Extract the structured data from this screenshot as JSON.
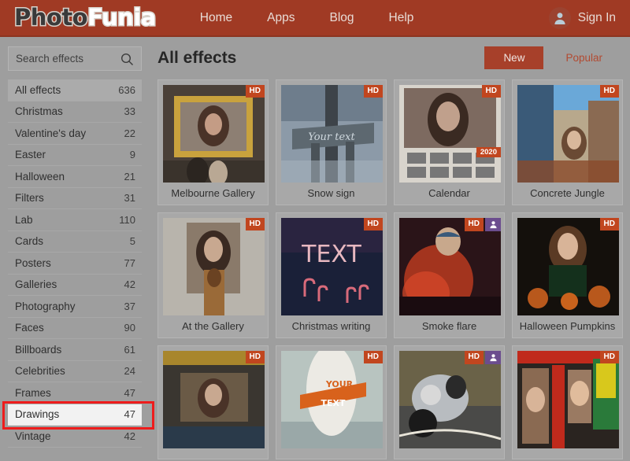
{
  "header": {
    "logo_part1": "Photo",
    "logo_part2": "Funia",
    "nav": [
      {
        "label": "Home"
      },
      {
        "label": "Apps"
      },
      {
        "label": "Blog"
      },
      {
        "label": "Help"
      }
    ],
    "signin_label": "Sign In",
    "avatar_icon": "user-avatar-icon",
    "bg_color": "#a03a24"
  },
  "sidebar": {
    "search": {
      "placeholder": "Search effects",
      "value": "",
      "icon": "search-icon"
    },
    "categories": [
      {
        "label": "All effects",
        "count": "636",
        "active": true,
        "highlighted": false
      },
      {
        "label": "Christmas",
        "count": "33",
        "active": false,
        "highlighted": false
      },
      {
        "label": "Valentine's day",
        "count": "22",
        "active": false,
        "highlighted": false
      },
      {
        "label": "Easter",
        "count": "9",
        "active": false,
        "highlighted": false
      },
      {
        "label": "Halloween",
        "count": "21",
        "active": false,
        "highlighted": false
      },
      {
        "label": "Filters",
        "count": "31",
        "active": false,
        "highlighted": false
      },
      {
        "label": "Lab",
        "count": "110",
        "active": false,
        "highlighted": false
      },
      {
        "label": "Cards",
        "count": "5",
        "active": false,
        "highlighted": false
      },
      {
        "label": "Posters",
        "count": "77",
        "active": false,
        "highlighted": false
      },
      {
        "label": "Galleries",
        "count": "42",
        "active": false,
        "highlighted": false
      },
      {
        "label": "Photography",
        "count": "37",
        "active": false,
        "highlighted": false
      },
      {
        "label": "Faces",
        "count": "90",
        "active": false,
        "highlighted": false
      },
      {
        "label": "Billboards",
        "count": "61",
        "active": false,
        "highlighted": false
      },
      {
        "label": "Celebrities",
        "count": "24",
        "active": false,
        "highlighted": false
      },
      {
        "label": "Frames",
        "count": "47",
        "active": false,
        "highlighted": false
      },
      {
        "label": "Drawings",
        "count": "47",
        "active": false,
        "highlighted": true
      },
      {
        "label": "Vintage",
        "count": "42",
        "active": false,
        "highlighted": false
      }
    ],
    "annotation_color": "#ee1c1c"
  },
  "main": {
    "title": "All effects",
    "sort": {
      "new_label": "New",
      "popular_label": "Popular",
      "selected": "New",
      "active_color": "#a7402a",
      "inactive_color": "#b24a31"
    },
    "effects": [
      {
        "name": "Melbourne Gallery",
        "hd": true,
        "face": false,
        "year": "",
        "art": "melbourne"
      },
      {
        "name": "Snow sign",
        "hd": true,
        "face": false,
        "year": "",
        "art": "snowsign"
      },
      {
        "name": "Calendar",
        "hd": true,
        "face": false,
        "year": "2020",
        "art": "calendar"
      },
      {
        "name": "Concrete Jungle",
        "hd": true,
        "face": false,
        "year": "",
        "art": "concrete"
      },
      {
        "name": "At the Gallery",
        "hd": true,
        "face": false,
        "year": "",
        "art": "atgallery"
      },
      {
        "name": "Christmas writing",
        "hd": true,
        "face": false,
        "year": "",
        "art": "xmaswriting"
      },
      {
        "name": "Smoke flare",
        "hd": true,
        "face": true,
        "year": "",
        "art": "smoke"
      },
      {
        "name": "Halloween Pumpkins",
        "hd": true,
        "face": false,
        "year": "",
        "art": "pumpkins"
      },
      {
        "name": "",
        "hd": true,
        "face": false,
        "year": "",
        "art": "museum"
      },
      {
        "name": "",
        "hd": true,
        "face": false,
        "year": "",
        "art": "surfboard"
      },
      {
        "name": "",
        "hd": true,
        "face": true,
        "year": "",
        "art": "motorcycle"
      },
      {
        "name": "",
        "hd": true,
        "face": false,
        "year": "",
        "art": "billboards"
      }
    ],
    "badge_hd_label": "HD",
    "badge_face_icon": "face-person-icon"
  }
}
